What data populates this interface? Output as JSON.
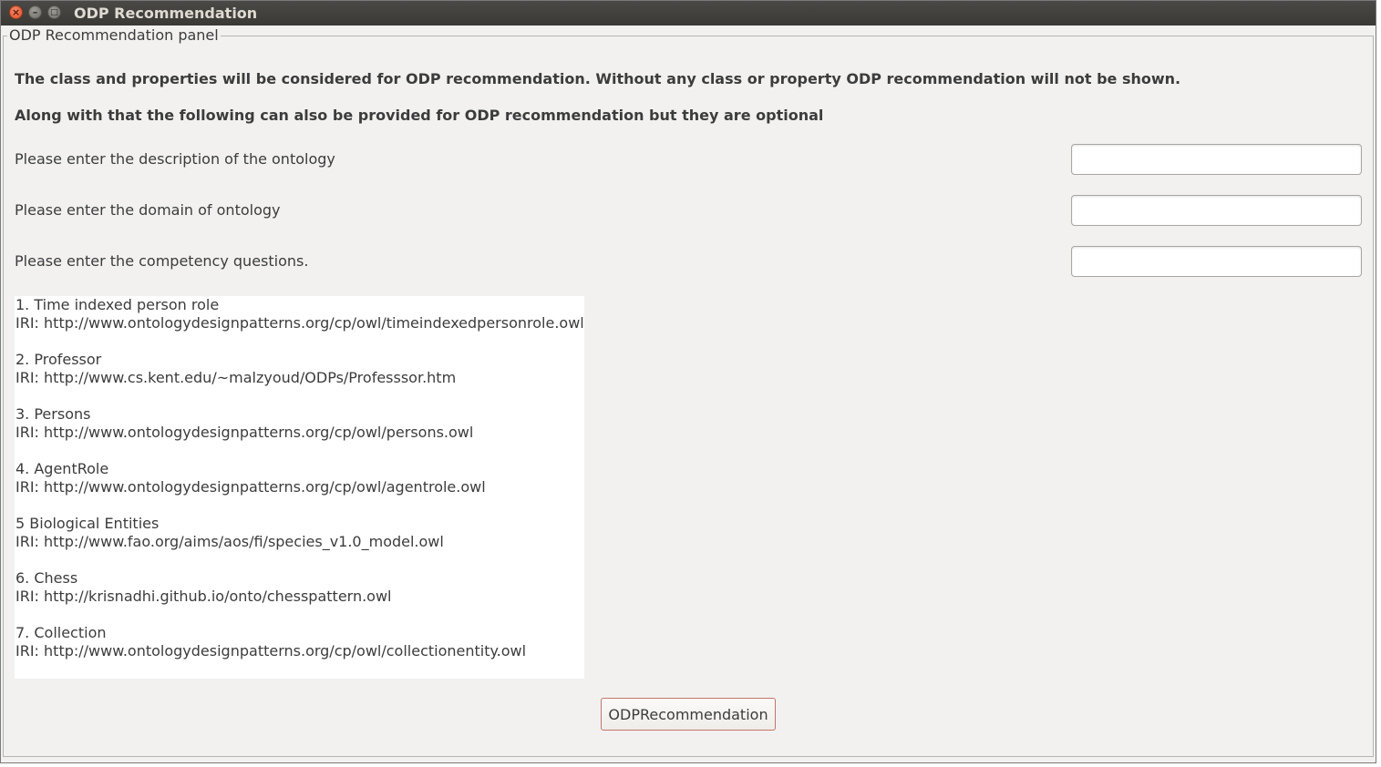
{
  "window": {
    "title": "ODP Recommendation"
  },
  "panel": {
    "legend": "ODP Recommendation panel",
    "intro_line_1": "The class and properties will be considered for ODP recommendation. Without any class or property ODP recommendation will not be shown.",
    "intro_line_2": "Along with that the following can also be provided for ODP recommendation but they are optional",
    "fields": [
      {
        "label": "Please enter the description of the ontology",
        "value": ""
      },
      {
        "label": "Please enter the domain of ontology",
        "value": ""
      },
      {
        "label": "Please enter the competency questions.",
        "value": ""
      }
    ]
  },
  "results": [
    {
      "title": "1. Time indexed person role",
      "iri": "IRI: http://www.ontologydesignpatterns.org/cp/owl/timeindexedpersonrole.owl"
    },
    {
      "title": "2. Professor",
      "iri": "IRI: http://www.cs.kent.edu/~malzyoud/ODPs/Professsor.htm"
    },
    {
      "title": "3. Persons",
      "iri": "IRI: http://www.ontologydesignpatterns.org/cp/owl/persons.owl"
    },
    {
      "title": "4. AgentRole",
      "iri": "IRI: http://www.ontologydesignpatterns.org/cp/owl/agentrole.owl"
    },
    {
      "title": "5 Biological Entities",
      "iri": "IRI: http://www.fao.org/aims/aos/fi/species_v1.0_model.owl"
    },
    {
      "title": "6. Chess",
      "iri": "IRI: http://krisnadhi.github.io/onto/chesspattern.owl"
    },
    {
      "title": "7. Collection",
      "iri": "IRI: http://www.ontologydesignpatterns.org/cp/owl/collectionentity.owl"
    }
  ],
  "buttons": {
    "recommend_label": "ODPRecommendation"
  },
  "icons": {
    "close": "close-icon",
    "minimize": "minimize-icon",
    "maximize": "maximize-icon"
  }
}
